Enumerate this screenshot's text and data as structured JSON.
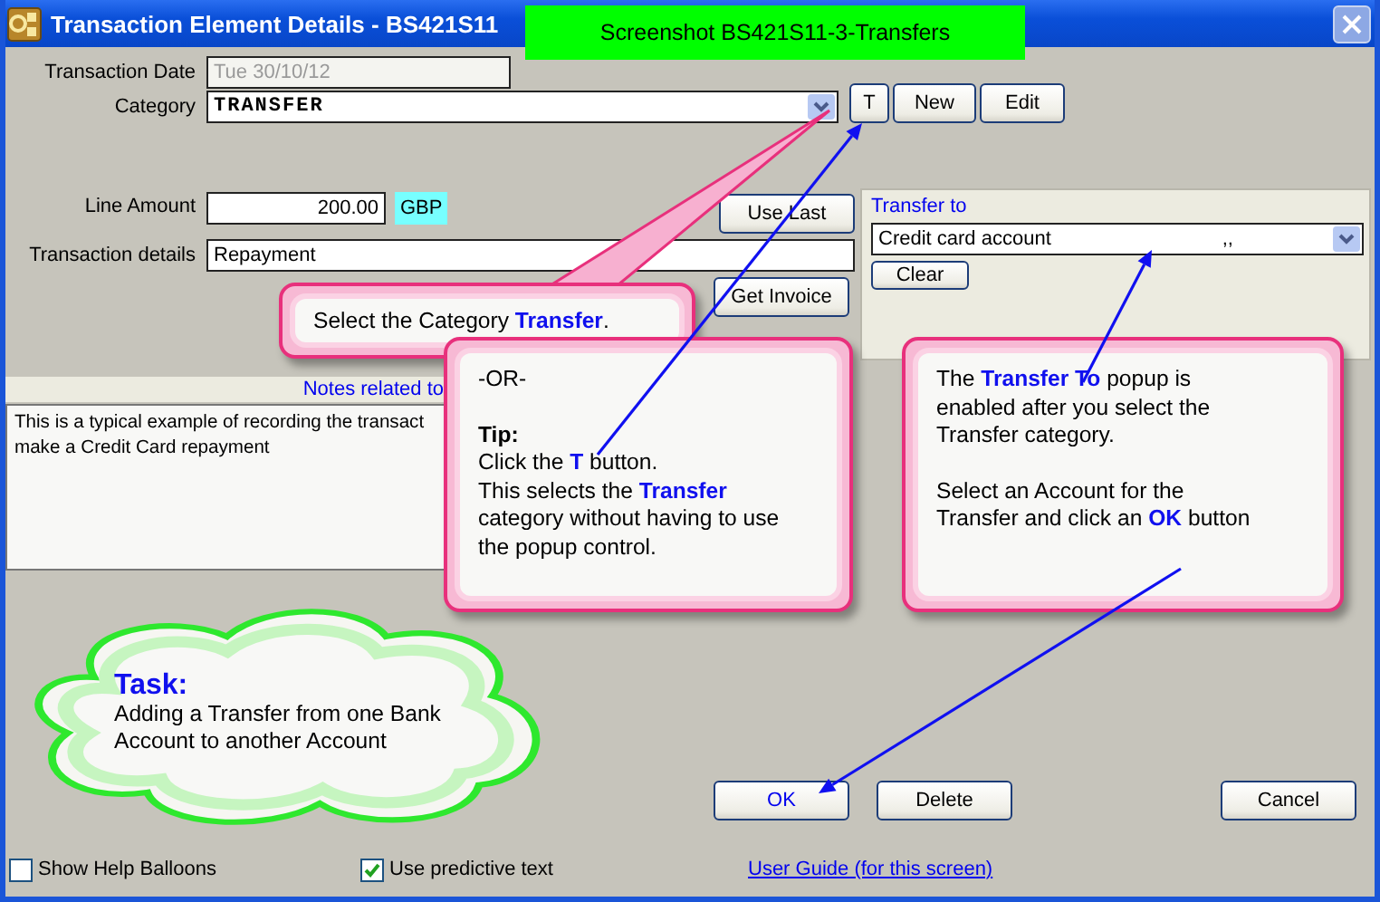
{
  "window": {
    "title": "Transaction Element Details - BS421S11"
  },
  "banner": {
    "text": "Screenshot BS421S11-3-Transfers"
  },
  "form": {
    "transaction_date": {
      "label": "Transaction Date",
      "value": "Tue 30/10/12",
      "disabled": true
    },
    "category": {
      "label": "Category",
      "value": "TRANSFER"
    },
    "category_buttons": [
      "T",
      "New",
      "Edit"
    ],
    "line_amount": {
      "label": "Line Amount",
      "value": "200.00",
      "currency": "GBP"
    },
    "transaction_details": {
      "label": "Transaction details",
      "value": "Repayment"
    },
    "side_buttons": [
      "Use Last",
      "Get Invoice"
    ],
    "transfer_to": {
      "label": "Transfer to",
      "value": "Credit card account",
      "suffix": ",,",
      "button": "Clear"
    },
    "notes": {
      "heading": "Notes related to",
      "lines": [
        "This is a typical example of recording the transact",
        "make a Credit Card repayment"
      ]
    }
  },
  "actions": [
    {
      "label": "OK",
      "default": true
    },
    {
      "label": "Delete",
      "default": false
    },
    {
      "label": "Cancel",
      "default": false
    }
  ],
  "footer": {
    "checkboxes": [
      {
        "label": "Show Help Balloons",
        "checked": false
      },
      {
        "label": "Use predictive text",
        "checked": true
      }
    ],
    "link": "User Guide (for this screen)"
  },
  "callouts": [
    {
      "kind": "tip",
      "paragraphs": [
        {
          "text": "Select the Category **Transfer**."
        }
      ]
    },
    {
      "kind": "tip",
      "paragraphs": [
        {
          "text": "-OR-"
        },
        {
          "heading": "Tip:",
          "text": "Click the **T** button.\nThis selects the **Transfer**\ncategory without having to use\nthe popup control."
        }
      ]
    },
    {
      "kind": "tip",
      "paragraphs": [
        {
          "text": "The **Transfer To** popup is\nenabled after you select the\nTransfer category."
        },
        {
          "text": "Select an Account for the\nTransfer and click an **OK** button"
        }
      ]
    },
    {
      "kind": "cloud",
      "paragraphs": [
        {
          "heading": "Task:",
          "text": "Adding a Transfer from one Bank\nAccount to another Account"
        }
      ]
    }
  ]
}
